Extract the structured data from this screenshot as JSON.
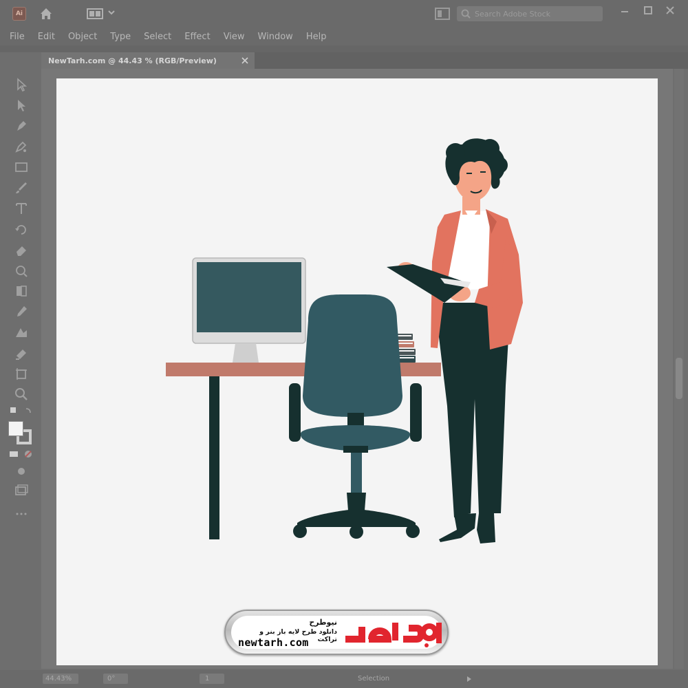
{
  "app": {
    "logo_text": "Ai"
  },
  "search": {
    "placeholder": "Search Adobe Stock"
  },
  "menu": {
    "items": [
      "File",
      "Edit",
      "Object",
      "Type",
      "Select",
      "Effect",
      "View",
      "Window",
      "Help"
    ]
  },
  "document": {
    "tab_title": "NewTarh.com @ 44.43 % (RGB/Preview)"
  },
  "status": {
    "zoom": "44.43%",
    "rotation": "0°",
    "artboard_number": "1",
    "mode": "Selection"
  },
  "watermark": {
    "brand_fa": "نیوطرح",
    "tagline_fa": "دانلود طرح لایه باز بنر و تراکت",
    "domain": "newtarh.com",
    "logo_fa": "نیوطرح",
    "logo_color": "#e1252e"
  },
  "colors": {
    "monitor_screen": "#35595f",
    "desk_top": "#c07a6b",
    "chair": "#325a63",
    "blazer": "#e2735f",
    "pants": "#16302f"
  },
  "icons": {
    "title": [
      "home-icon",
      "workspace-icon",
      "arrange-documents-icon",
      "search-icon",
      "minimize-icon",
      "maximize-icon",
      "close-icon"
    ],
    "tools": [
      "selection-tool-icon",
      "direct-selection-tool-icon",
      "pen-tool-icon",
      "curvature-tool-icon",
      "rectangle-tool-icon",
      "paintbrush-tool-icon",
      "type-tool-icon",
      "rotate-tool-icon",
      "eraser-tool-icon",
      "scale-tool-icon",
      "width-tool-icon",
      "eyedropper-tool-icon",
      "blend-tool-icon",
      "live-paint-tool-icon",
      "artboard-tool-icon",
      "zoom-tool-icon"
    ]
  }
}
